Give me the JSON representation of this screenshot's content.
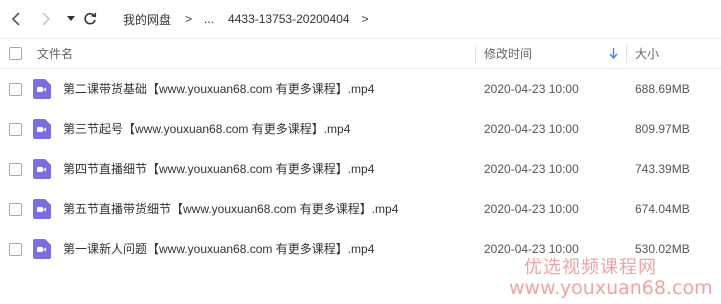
{
  "toolbar": {
    "back_icon": "chevron-left-icon",
    "forward_icon": "chevron-right-icon",
    "dropdown_icon": "caret-down-icon",
    "refresh_icon": "refresh-icon"
  },
  "breadcrumb": {
    "items": [
      "我的网盘",
      "...",
      "4433-13753-20200404"
    ],
    "separator": ">"
  },
  "table": {
    "columns": {
      "name": "文件名",
      "modified": "修改时间",
      "size": "大小"
    },
    "sort_icon": "sort-down-arrow-icon",
    "sort_color": "#2f8ce9",
    "rows": [
      {
        "name": "第二课带货基础【www.youxuan68.com 有更多课程】.mp4",
        "modified": "2020-04-23 10:00",
        "size": "688.69MB"
      },
      {
        "name": "第三节起号【www.youxuan68.com 有更多课程】.mp4",
        "modified": "2020-04-23 10:00",
        "size": "809.97MB"
      },
      {
        "name": "第四节直播细节【www.youxuan68.com 有更多课程】.mp4",
        "modified": "2020-04-23 10:00",
        "size": "743.39MB"
      },
      {
        "name": "第五节直播带货细节【www.youxuan68.com 有更多课程】.mp4",
        "modified": "2020-04-23 10:00",
        "size": "674.04MB"
      },
      {
        "name": "第一课新人问题【www.youxuan68.com 有更多课程】.mp4",
        "modified": "2020-04-23 10:00",
        "size": "530.02MB"
      }
    ],
    "file_icon": "video-file-icon",
    "file_icon_color": "#7b6fe0"
  },
  "watermark": {
    "line1": "优选视频课程网",
    "line2": "www.youxuan68.com",
    "color": "#f0a3a3"
  }
}
